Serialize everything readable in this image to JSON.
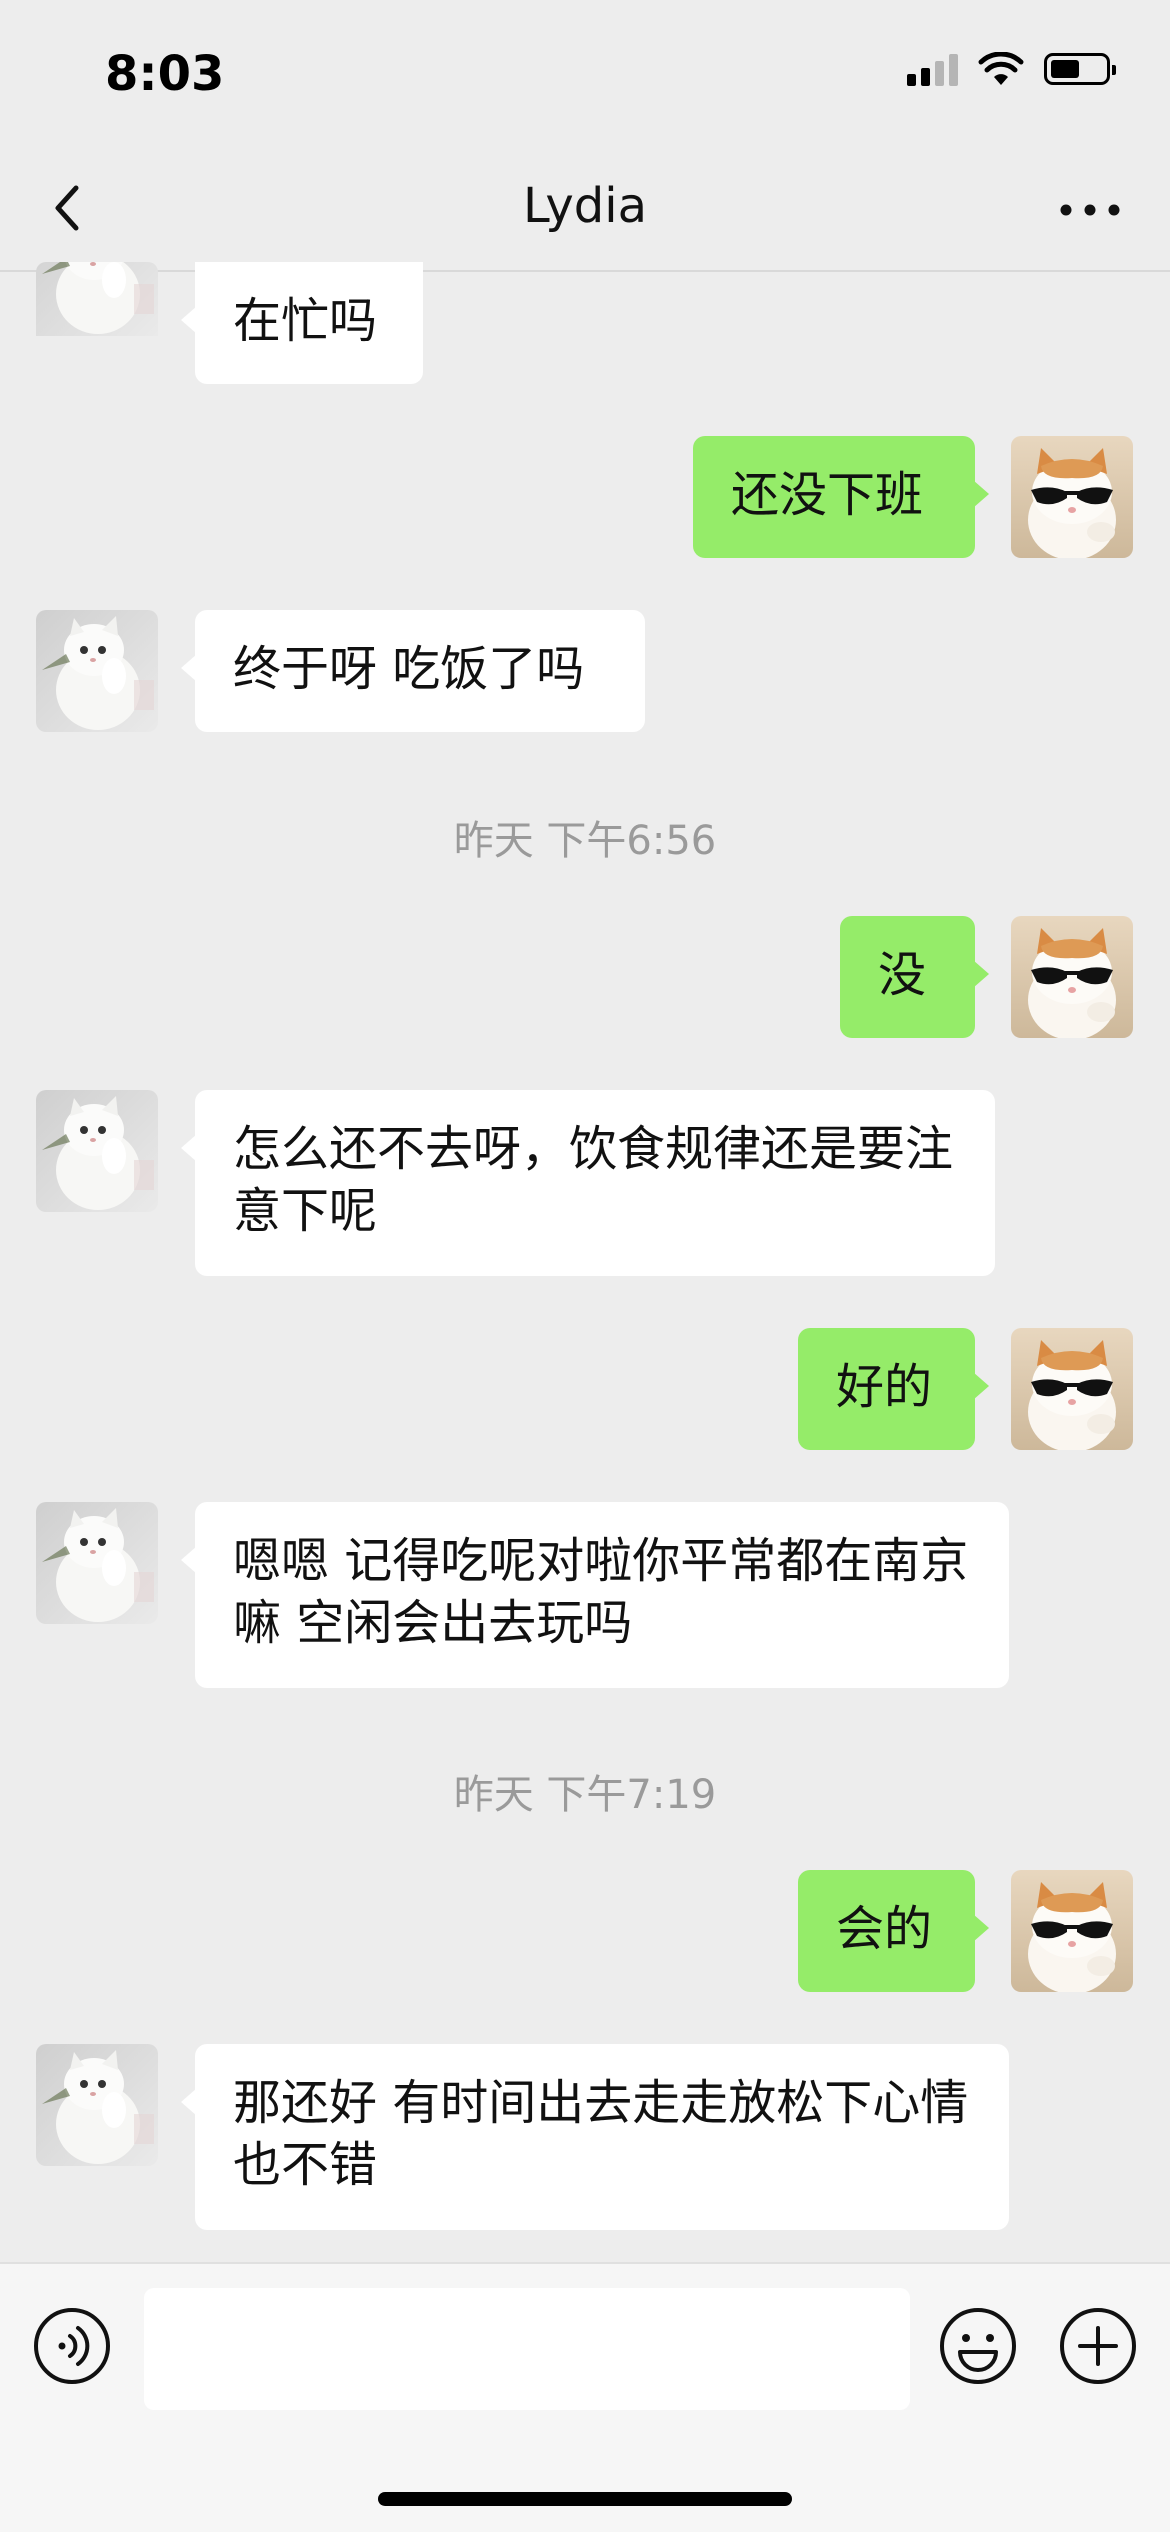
{
  "status_bar": {
    "time": "8:03",
    "icons": [
      "cellular-signal-icon",
      "wifi-icon",
      "battery-icon"
    ]
  },
  "nav": {
    "title": "Lydia",
    "back_icon": "chevron-left-icon",
    "more_icon": "more-dots-icon"
  },
  "colors": {
    "background": "#ededed",
    "outgoing_bubble": "#95ec69",
    "incoming_bubble": "#ffffff",
    "timestamp": "#9a9a9a"
  },
  "messages": [
    {
      "side": "in",
      "text": "在忙吗"
    },
    {
      "side": "out",
      "text": "还没下班"
    },
    {
      "side": "in",
      "text": "终于呀 吃饭了吗"
    },
    {
      "type": "time",
      "text": "昨天 下午6:56"
    },
    {
      "side": "out",
      "text": "没"
    },
    {
      "side": "in",
      "text": "怎么还不去呀，饮食规律还是要注意下呢"
    },
    {
      "side": "out",
      "text": "好的"
    },
    {
      "side": "in",
      "text": "嗯嗯 记得吃呢对啦你平常都在南京嘛 空闲会出去玩吗"
    },
    {
      "type": "time",
      "text": "昨天 下午7:19"
    },
    {
      "side": "out",
      "text": "会的"
    },
    {
      "side": "in",
      "text": "那还好 有时间出去走走放松下心情也不错"
    }
  ],
  "input_bar": {
    "value": "",
    "icons": [
      "voice-icon",
      "emoji-icon",
      "plus-icon"
    ]
  }
}
